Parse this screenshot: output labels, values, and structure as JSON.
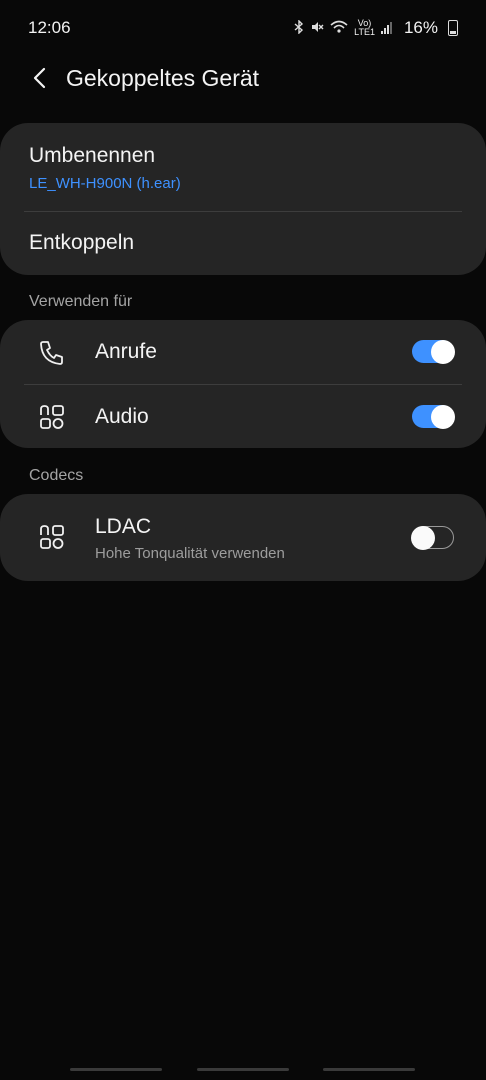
{
  "status": {
    "time": "12:06",
    "lte_label": "LTE1",
    "battery": "16%"
  },
  "header": {
    "title": "Gekoppeltes Gerät"
  },
  "device_card": {
    "rename_label": "Umbenennen",
    "device_name": "LE_WH-H900N (h.ear)",
    "unpair_label": "Entkoppeln"
  },
  "use_for": {
    "section_label": "Verwenden für",
    "items": [
      {
        "label": "Anrufe",
        "icon": "phone-icon",
        "enabled": true
      },
      {
        "label": "Audio",
        "icon": "audio-apps-icon",
        "enabled": true
      }
    ]
  },
  "codecs": {
    "section_label": "Codecs",
    "items": [
      {
        "label": "LDAC",
        "sublabel": "Hohe Tonqualität verwenden",
        "icon": "codec-icon",
        "enabled": false
      }
    ]
  },
  "colors": {
    "accent": "#3e91ff",
    "card": "#252525",
    "background": "#080808"
  }
}
